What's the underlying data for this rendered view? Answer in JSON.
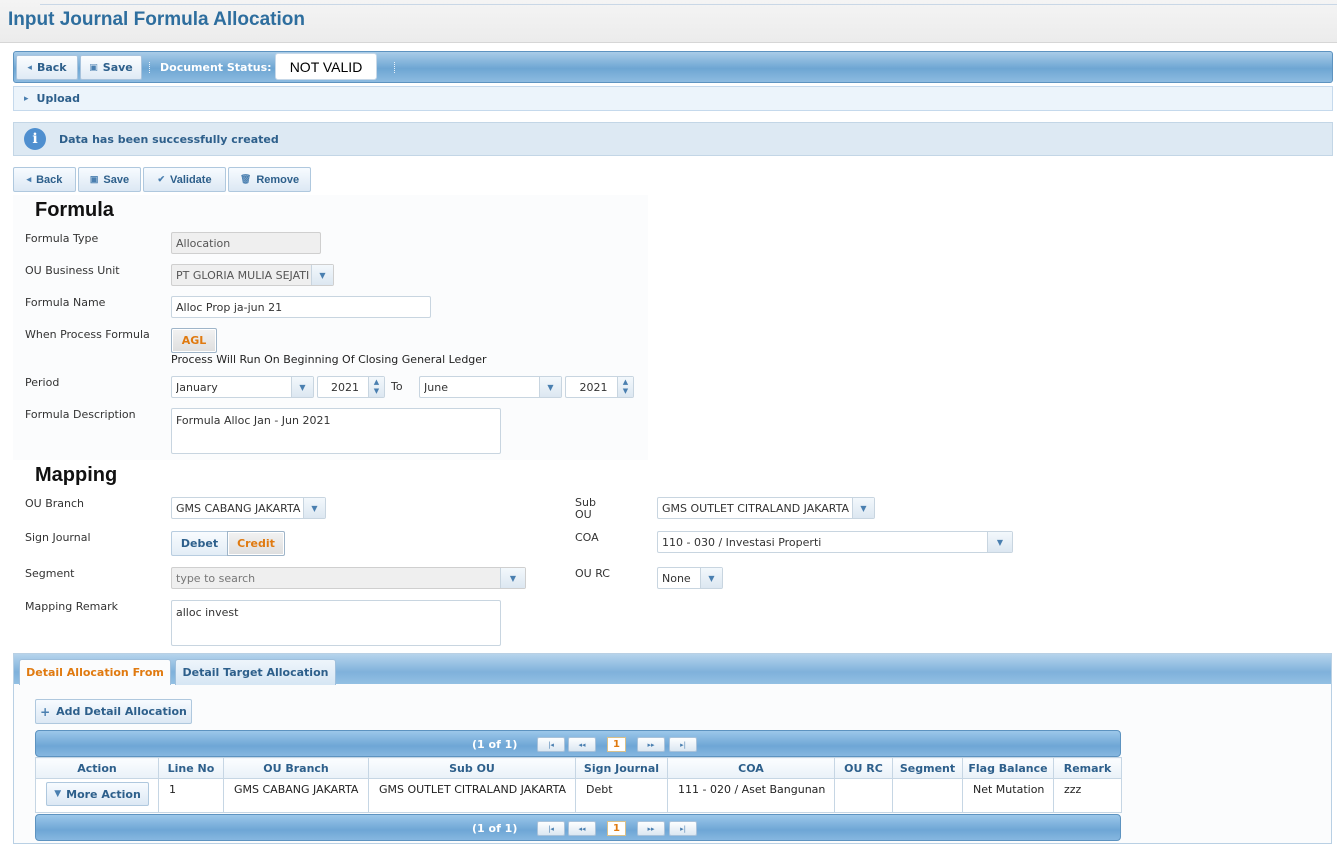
{
  "page": {
    "title": "Input Journal Formula Allocation"
  },
  "top_toolbar": {
    "back_label": "Back",
    "save_label": "Save",
    "doc_status_label": "Document Status:",
    "doc_status_value": "NOT VALID"
  },
  "upload": {
    "label": "Upload"
  },
  "message": {
    "text": "Data has been successfully created"
  },
  "actions": {
    "back_label": "Back",
    "save_label": "Save",
    "validate_label": "Validate",
    "remove_label": "Remove"
  },
  "formula": {
    "section_title": "Formula",
    "type_label": "Formula Type",
    "type_value": "Allocation",
    "ou_label": "OU Business Unit",
    "ou_value": "PT GLORIA MULIA SEJATI",
    "name_label": "Formula Name",
    "name_value": "Alloc Prop ja-jun 21",
    "when_label": "When Process Formula",
    "when_button": "AGL",
    "when_note": "Process Will Run On Beginning Of Closing General Ledger",
    "period_label": "Period",
    "period_from_month": "January",
    "period_from_year": "2021",
    "period_to_label": "To",
    "period_to_month": "June",
    "period_to_year": "2021",
    "desc_label": "Formula Description",
    "desc_value": "Formula Alloc Jan - Jun 2021"
  },
  "mapping": {
    "section_title": "Mapping",
    "branch_label": "OU Branch",
    "branch_value": "GMS CABANG JAKARTA",
    "sub_ou_label_1": "Sub",
    "sub_ou_label_2": "OU",
    "sub_ou_value": "GMS OUTLET CITRALAND JAKARTA",
    "sign_label": "Sign Journal",
    "sign_debet": "Debet",
    "sign_credit": "Credit",
    "coa_label": "COA",
    "coa_value": "110 - 030 / Investasi Properti",
    "segment_label": "Segment",
    "segment_placeholder": "type to search",
    "ou_rc_label": "OU RC",
    "ou_rc_value": "None",
    "remark_label": "Mapping Remark",
    "remark_value": "alloc invest"
  },
  "tabs": [
    {
      "label": "Detail Allocation From",
      "active": true
    },
    {
      "label": "Detail Target Allocation",
      "active": false
    }
  ],
  "detail": {
    "add_button": "Add Detail Allocation",
    "pager_info": "(1 of 1)",
    "current_page": "1",
    "columns": [
      "Action",
      "Line No",
      "OU Branch",
      "Sub OU",
      "Sign Journal",
      "COA",
      "OU RC",
      "Segment",
      "Flag Balance",
      "Remark"
    ],
    "rows": [
      {
        "action": "More Action",
        "line_no": "1",
        "ou_branch": "GMS CABANG JAKARTA",
        "sub_ou": "GMS OUTLET CITRALAND JAKARTA",
        "sign_journal": "Debt",
        "coa": "111 - 020 / Aset Bangunan",
        "ou_rc": "",
        "segment": "",
        "flag_balance": "Net Mutation",
        "remark": "zzz"
      }
    ]
  },
  "colors": {
    "accent": "#2e6e9e",
    "active_tab": "#e07a10",
    "toolbar": "#6ea6d3"
  }
}
